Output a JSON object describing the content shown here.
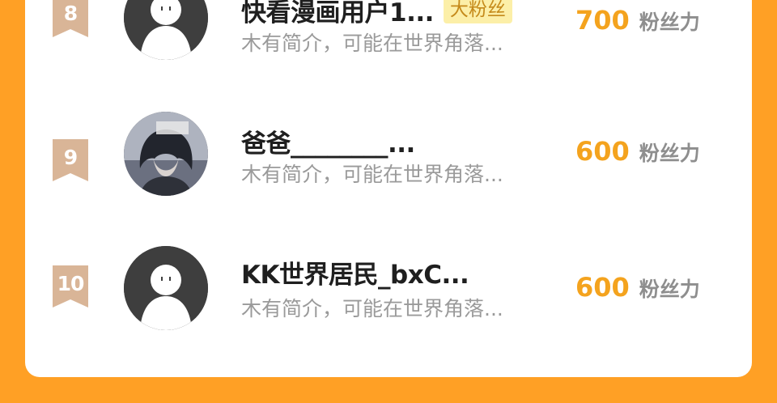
{
  "colors": {
    "background": "#FFA025",
    "card": "#FFFFFF",
    "badge": "#D9B597",
    "score": "#F4A31E",
    "tag_bg": "#FCEFA8",
    "tag_text": "#C58A1A"
  },
  "rows": [
    {
      "rank": "8",
      "name": "快看漫画用户1...",
      "tag": "大粉丝",
      "bio": "木有简介，可能在世界角落...",
      "score": "700",
      "score_unit": "粉丝力",
      "avatar": "default-person-icon"
    },
    {
      "rank": "9",
      "name": "爸爸________...",
      "tag": "",
      "bio": "木有简介，可能在世界角落...",
      "score": "600",
      "score_unit": "粉丝力",
      "avatar": "anime-character-photo"
    },
    {
      "rank": "10",
      "name": "KK世界居民_bxC...",
      "tag": "",
      "bio": "木有简介，可能在世界角落...",
      "score": "600",
      "score_unit": "粉丝力",
      "avatar": "default-person-icon"
    }
  ]
}
